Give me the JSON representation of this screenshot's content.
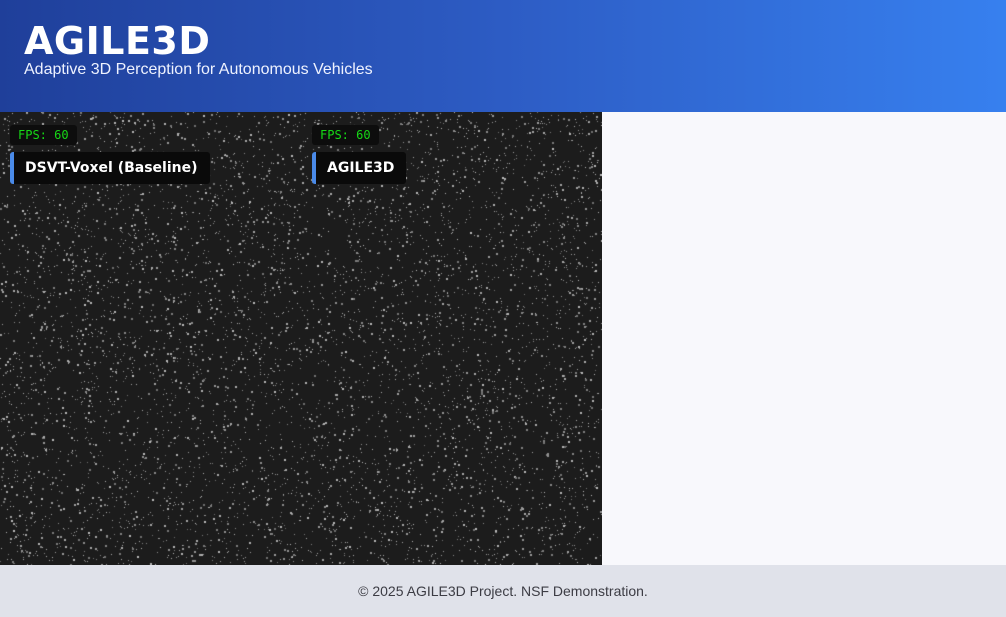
{
  "header": {
    "title": "AGILE3D",
    "subtitle": "Adaptive 3D Perception for Autonomous Vehicles"
  },
  "viewers": [
    {
      "fps_text": "FPS: 60",
      "model_label": "DSVT-Voxel (Baseline)"
    },
    {
      "fps_text": "FPS: 60",
      "model_label": "AGILE3D"
    }
  ],
  "footer": {
    "text": "© 2025 AGILE3D Project. NSF Demonstration."
  },
  "colors": {
    "header_gradient_start": "#1f3f9a",
    "header_gradient_end": "#3780ef",
    "viewer_background": "#1c1c1c",
    "point_color": "#9a9a9a",
    "fps_text": "#16d916",
    "label_accent": "#4a8ae8"
  }
}
